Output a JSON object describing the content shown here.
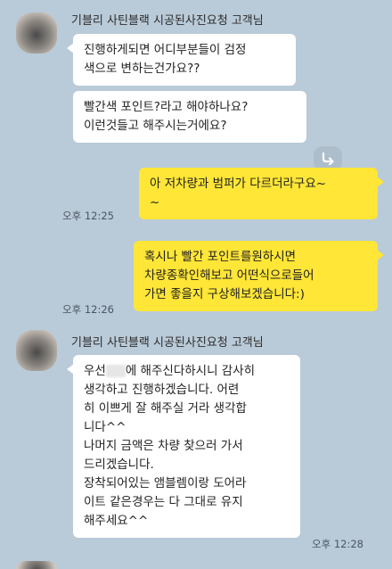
{
  "messages": [
    {
      "sender": "기블리 사틴블랙 시공된사진요청 고객님",
      "bubbles": [
        "진행하게되면 어디부분들이 검정\n색으로 변하는건가요??",
        "빨간색 포인트?라고 해야하나요?\n이런것들고 해주시는거에요?"
      ]
    },
    {
      "time": "오후 12:25",
      "text": "아 저차량과 범퍼가 다르더라구요~\n~"
    },
    {
      "time": "오후 12:26",
      "text": "혹시나 빨간 포인트를원하시면\n차량종확인해보고 어떤식으로들어\n가면 좋을지 구상해보겠습니다:)"
    },
    {
      "sender": "기블리 사틴블랙 시공된사진요청 고객님",
      "text_before": "우선",
      "text_after": "에 해주신다하시니 감사히\n 생각하고 진행하겠습니다. 어련\n히 이쁘게 잘 해주실 거라 생각합\n니다^^\n나머지 금액은 차량 찾으러 가서\n드리겠습니다.\n장착되어있는 앰블렘이랑 도어라\n이트 같은경우는 다 그대로 유지\n해주세요^^",
      "time": "오후 12:28"
    }
  ],
  "icons": {
    "share": "share-arrow-icon",
    "avatar": "profile-avatar"
  },
  "colors": {
    "background": "#b9cad8",
    "incoming": "#ffffff",
    "outgoing": "#ffe637"
  }
}
